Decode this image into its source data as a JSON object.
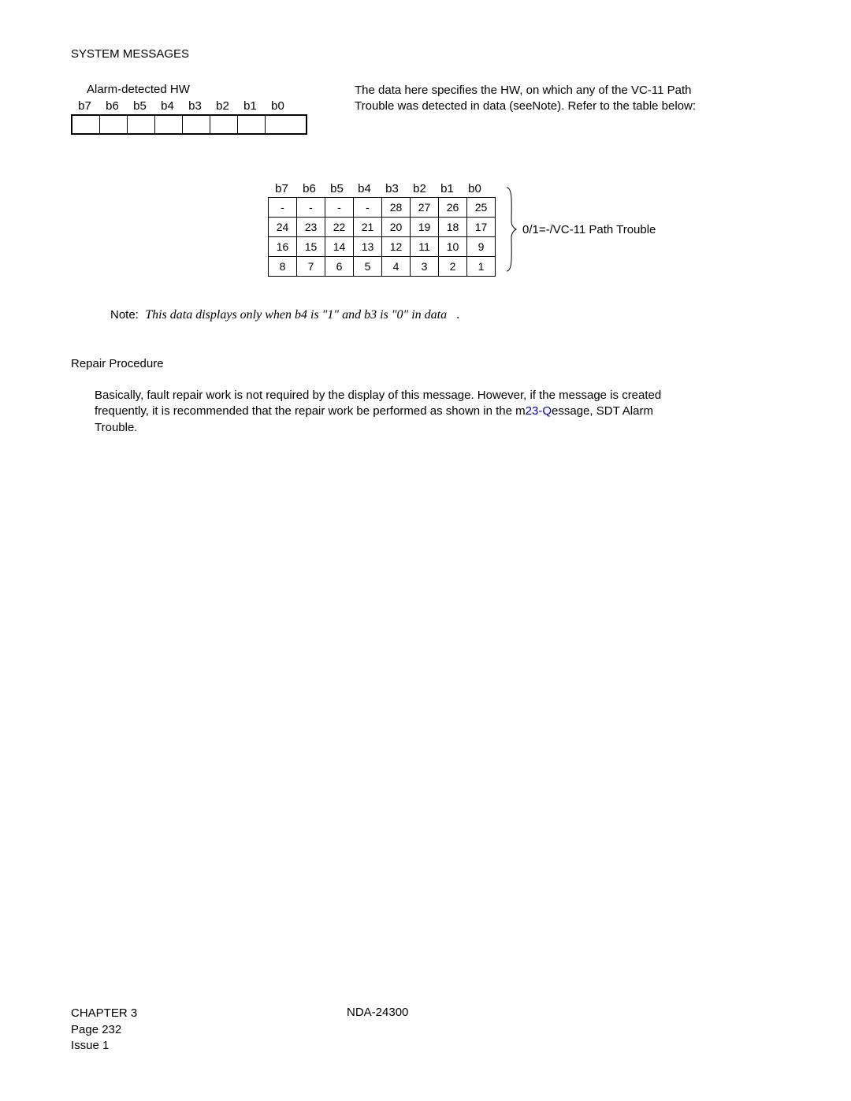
{
  "header": "SYSTEM MESSAGES",
  "alarm_title": "Alarm-detected HW",
  "bit_labels": [
    "b7",
    "b6",
    "b5",
    "b4",
    "b3",
    "b2",
    "b1",
    "b0"
  ],
  "desc_line1": "The data here specifies the HW, on which any of the VC-11 Path",
  "desc_line2_a": "Trouble was detected in data (see",
  "desc_line2_b": "Note",
  "desc_line2_c": "). Refer to the table below:",
  "grid_header": [
    "b7",
    "b6",
    "b5",
    "b4",
    "b3",
    "b2",
    "b1",
    "b0"
  ],
  "grid_rows": [
    [
      "-",
      "-",
      "-",
      "-",
      "28",
      "27",
      "26",
      "25"
    ],
    [
      "24",
      "23",
      "22",
      "21",
      "20",
      "19",
      "18",
      "17"
    ],
    [
      "16",
      "15",
      "14",
      "13",
      "12",
      "11",
      "10",
      "9"
    ],
    [
      "8",
      "7",
      "6",
      "5",
      "4",
      "3",
      "2",
      "1"
    ]
  ],
  "legend": "0/1=-/VC-11 Path Trouble",
  "note_label": "Note:",
  "note_body_a": "This data displays only when b4 is \"1\" and b3 is \"0\" in data",
  "note_body_b": ".",
  "repair_heading": "Repair Procedure",
  "repair_text_1": "Basically, fault repair work is not required by the display of this message. However, if the message is created",
  "repair_text_2a": "frequently, it is recommended that the repair work be performed as shown in the m",
  "repair_text_2b": "essage,",
  "repair_text_2c": "23-Q",
  "repair_text_2d": "SDT Alarm",
  "repair_text_3": "Trouble.",
  "footer": {
    "chapter": "CHAPTER 3",
    "page": "Page 232",
    "issue": "Issue 1",
    "docnum": "NDA-24300"
  }
}
